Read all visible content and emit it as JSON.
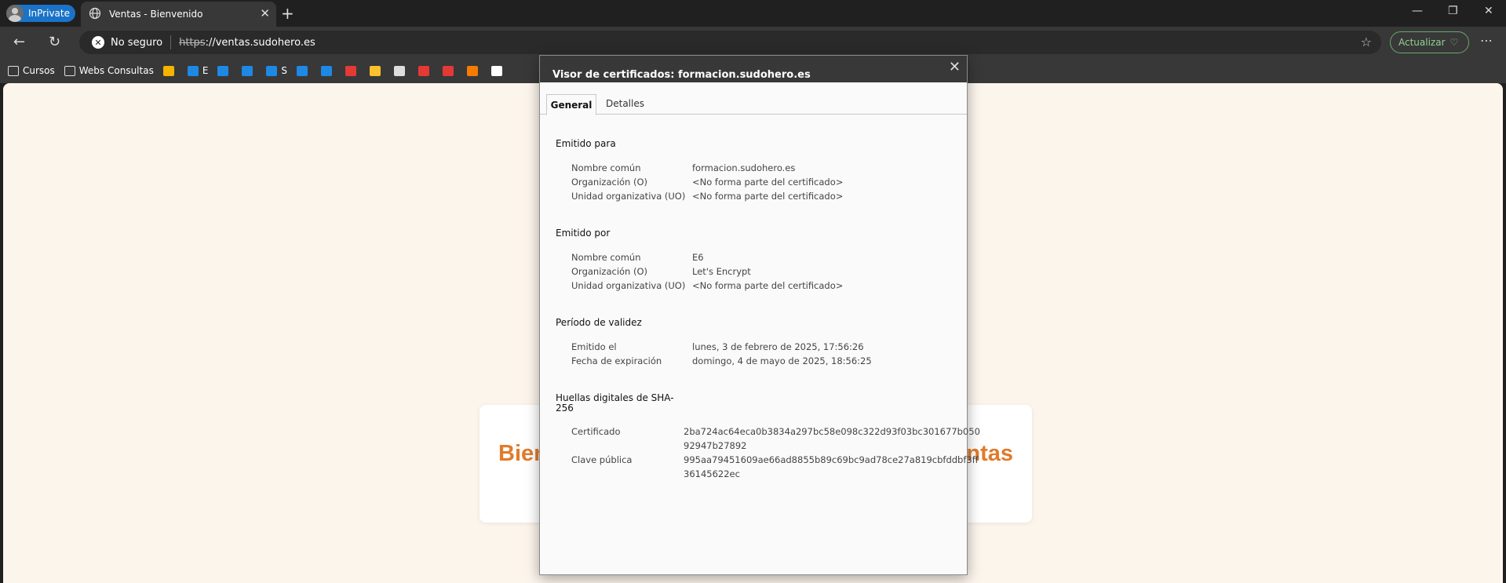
{
  "window": {
    "inprivate_label": "InPrivate",
    "tab_title": "Ventas - Bienvenido",
    "tab_close": "✕",
    "new_tab": "+",
    "minimize": "—",
    "restore": "❐",
    "close": "✕"
  },
  "toolbar": {
    "back": "←",
    "reload": "↻",
    "security_label": "No seguro",
    "url_scheme": "https",
    "url_rest": "://ventas.sudohero.es",
    "update_label": "Actualizar",
    "more": "⋯"
  },
  "favorites": [
    {
      "label": "Cursos",
      "icon": "folder-icon",
      "color": "transparent"
    },
    {
      "label": "Webs Consultas",
      "icon": "folder-icon",
      "color": "transparent"
    },
    {
      "label": "",
      "icon": "drive-icon",
      "color": "#f4b400"
    },
    {
      "label": "E",
      "icon": "graduation-cap-icon",
      "color": "#1e88e5"
    },
    {
      "label": "",
      "icon": "graduation-cap-icon",
      "color": "#1e88e5"
    },
    {
      "label": "",
      "icon": "cloud-icon",
      "color": "#1e88e5"
    },
    {
      "label": "S",
      "icon": "cloud-icon",
      "color": "#1e88e5"
    },
    {
      "label": "",
      "icon": "mail-icon",
      "color": "#1e88e5"
    },
    {
      "label": "",
      "icon": "calendar-icon",
      "color": "#1e88e5"
    },
    {
      "label": "",
      "icon": "check-circle-icon",
      "color": "#e53935"
    },
    {
      "label": "",
      "icon": "medal-icon",
      "color": "#fbc02d"
    },
    {
      "label": "",
      "icon": "penguin-icon",
      "color": "#dddddd"
    },
    {
      "label": "",
      "icon": "app-icon",
      "color": "#e53935"
    },
    {
      "label": "",
      "icon": "spinner-icon",
      "color": "#e53935"
    },
    {
      "label": "",
      "icon": "x-logo-icon",
      "color": "#f57c00"
    },
    {
      "label": "",
      "icon": "github-icon",
      "color": "#ffffff"
    }
  ],
  "page": {
    "heading_left": "Bien",
    "heading_right": "ntas"
  },
  "dialog": {
    "title": "Visor de certificados: formacion.sudohero.es",
    "close": "✕",
    "tabs": [
      "General",
      "Detalles"
    ],
    "issued_to": {
      "heading": "Emitido para",
      "rows": [
        {
          "label": "Nombre común",
          "value": "formacion.sudohero.es"
        },
        {
          "label": "Organización (O)",
          "value": "<No forma parte del certificado>"
        },
        {
          "label": "Unidad organizativa (UO)",
          "value": "<No forma parte del certificado>"
        }
      ]
    },
    "issued_by": {
      "heading": "Emitido por",
      "rows": [
        {
          "label": "Nombre común",
          "value": "E6"
        },
        {
          "label": "Organización (O)",
          "value": "Let's Encrypt"
        },
        {
          "label": "Unidad organizativa (UO)",
          "value": "<No forma parte del certificado>"
        }
      ]
    },
    "validity": {
      "heading": "Período de validez",
      "rows": [
        {
          "label": "Emitido el",
          "value": "lunes, 3 de febrero de 2025, 17:56:26"
        },
        {
          "label": "Fecha de expiración",
          "value": "domingo, 4 de mayo de 2025, 18:56:25"
        }
      ]
    },
    "fingerprints": {
      "heading_line1": "Huellas digitales de SHA-",
      "heading_line2": "256",
      "rows": [
        {
          "label": "Certificado",
          "line1": "2ba724ac64eca0b3834a297bc58e098c322d93f03bc301677b050",
          "line2": "92947b27892"
        },
        {
          "label": "Clave pública",
          "line1": "995aa79451609ae66ad8855b89c69bc9ad78ce27a819cbfddbf3ff",
          "line2": "36145622ec"
        }
      ]
    }
  }
}
